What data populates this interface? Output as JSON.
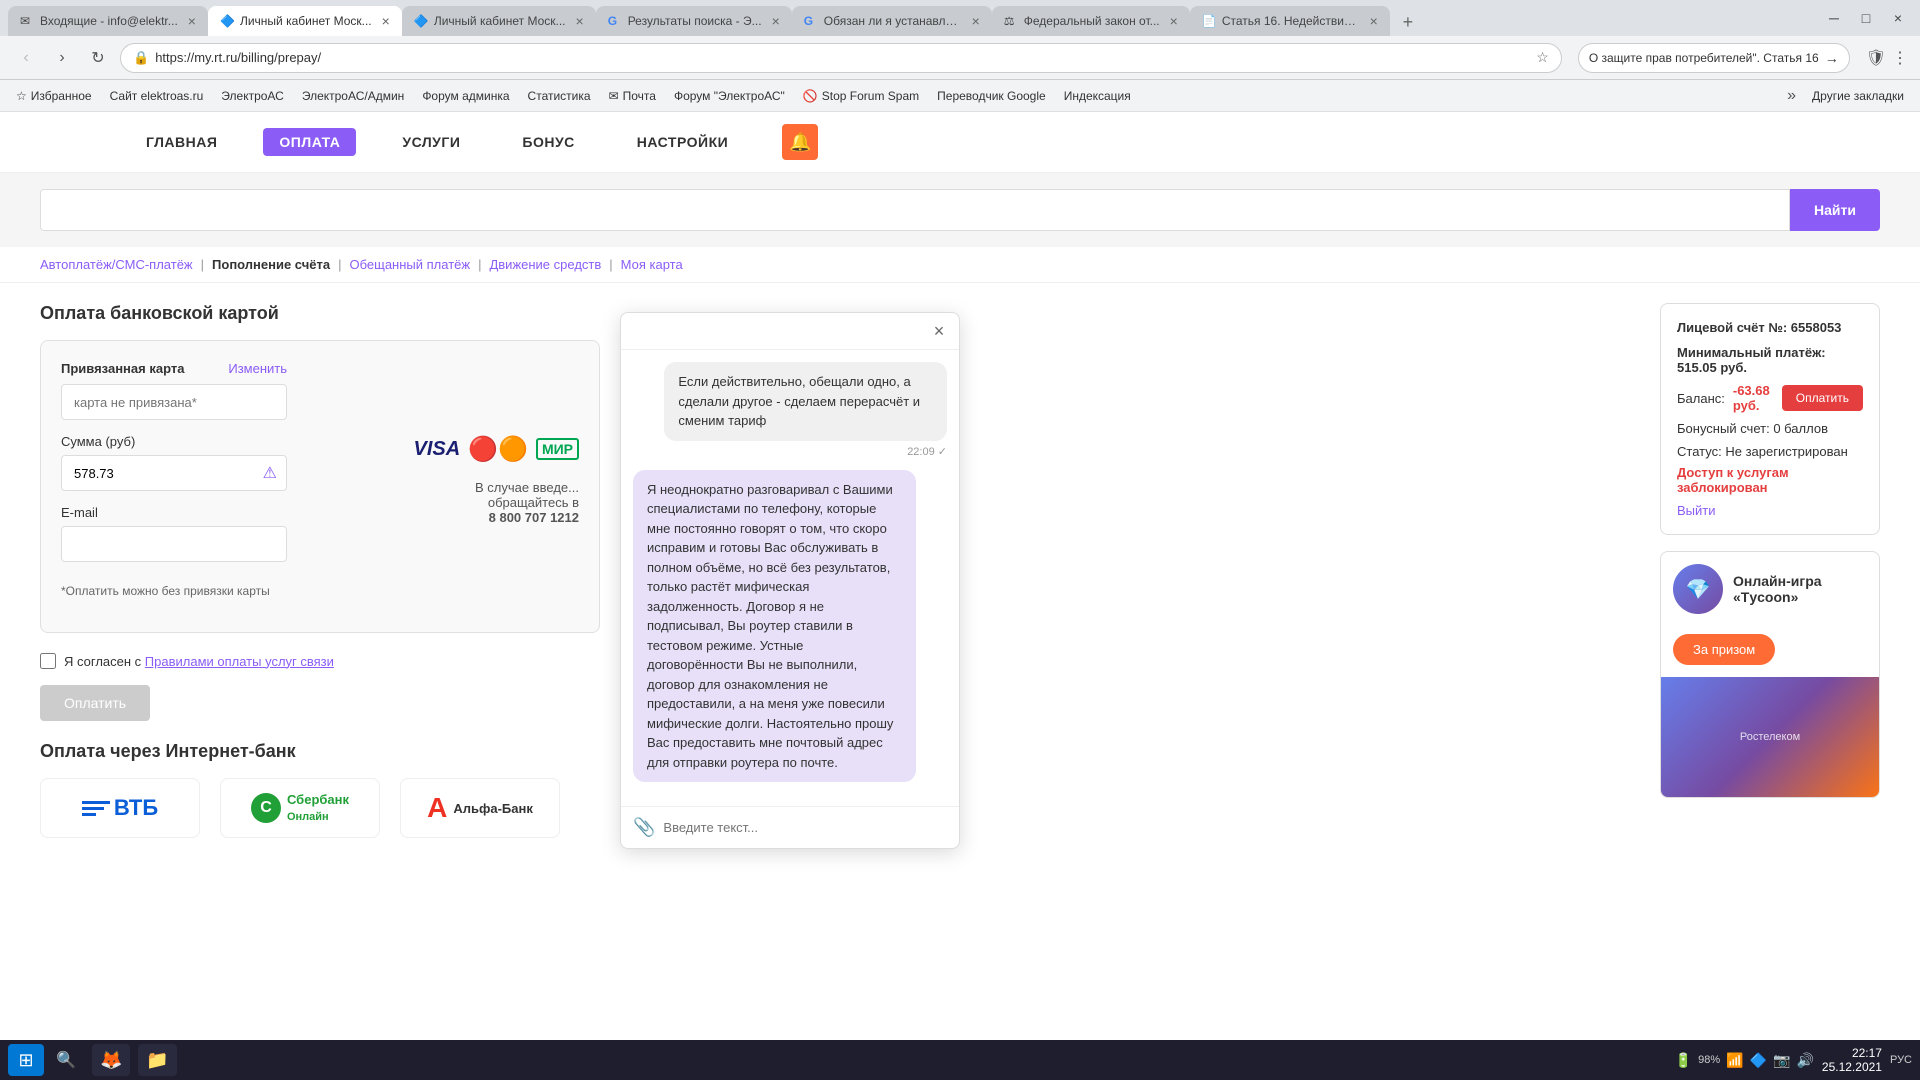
{
  "browser": {
    "tabs": [
      {
        "id": 1,
        "title": "Входящие - info@elektr...",
        "active": false,
        "favicon": "✉"
      },
      {
        "id": 2,
        "title": "Личный кабинет Моск...",
        "active": true,
        "favicon": "🔷"
      },
      {
        "id": 3,
        "title": "Личный кабинет Моск...",
        "active": false,
        "favicon": "🔷"
      },
      {
        "id": 4,
        "title": "Результаты поиска - Э...",
        "active": false,
        "favicon": "G"
      },
      {
        "id": 5,
        "title": "Обязан ли я устанавли...",
        "active": false,
        "favicon": "G"
      },
      {
        "id": 6,
        "title": "Федеральный закон от...",
        "active": false,
        "favicon": "⚖"
      },
      {
        "id": 7,
        "title": "Статья 16. Недействите...",
        "active": false,
        "favicon": "📄"
      }
    ],
    "address": "https://my.rt.ru/billing/prepay/",
    "search_right": "О защите прав потребителей\". Статья 16"
  },
  "bookmarks": [
    {
      "label": "Избранное"
    },
    {
      "label": "Сайт elektroas.ru"
    },
    {
      "label": "ЭлектроАС"
    },
    {
      "label": "ЭлектроАС/Админ"
    },
    {
      "label": "Форум админка"
    },
    {
      "label": "Статистика"
    },
    {
      "label": "Почта"
    },
    {
      "label": "Форум \"ЭлектроАС\""
    },
    {
      "label": "Stop Forum Spam"
    },
    {
      "label": "Переводчик Google"
    },
    {
      "label": "Индексация"
    }
  ],
  "nav": {
    "items": [
      {
        "label": "ГЛАВНАЯ",
        "active": false
      },
      {
        "label": "ОПЛАТА",
        "active": true
      },
      {
        "label": "УСЛУГИ",
        "active": false
      },
      {
        "label": "БОНУС",
        "active": false
      },
      {
        "label": "НАСТРОЙКИ",
        "active": false
      }
    ]
  },
  "search": {
    "placeholder": "",
    "button_label": "Найти"
  },
  "breadcrumb": {
    "items": [
      {
        "label": "Автоплатёж/СМС-платёж",
        "active": false
      },
      {
        "label": "Пополнение счёта",
        "active": true
      },
      {
        "label": "Обещанный платёж",
        "active": false
      },
      {
        "label": "Движение средств",
        "active": false
      },
      {
        "label": "Моя карта",
        "active": false
      }
    ]
  },
  "payment_card": {
    "section_title": "Оплата банковской картой",
    "linked_card_label": "Привязанная карта",
    "change_link": "Изменить",
    "card_placeholder": "карта не привязана*",
    "amount_label": "Сумма (руб)",
    "amount_value": "578.73",
    "email_label": "E-mail",
    "email_placeholder": "",
    "note": "*Оплатить можно без привязки карты",
    "phone_note": "В случае введе... обращайтесь в 8 800 707 1212",
    "phone": "8 800 707 1212",
    "phone_prefix": "В случае введе... обращайтесь в"
  },
  "checkbox": {
    "label": "Я согласен с ",
    "link_label": "Правилами оплаты услуг связи"
  },
  "pay_button": "Оплатить",
  "internet_bank": {
    "title": "Оплата через Интернет-банк"
  },
  "sidebar": {
    "account_label": "Лицевой счёт №:",
    "account_number": "6558053",
    "min_payment_label": "Минимальный платёж:",
    "min_payment_value": "515.05",
    "min_payment_currency": "руб.",
    "balance_label": "Баланс:",
    "balance_value": "-63.68",
    "balance_currency": "руб.",
    "pay_button": "Оплатить",
    "bonus_label": "Бонусный счет:",
    "bonus_value": "0 баллов",
    "status_label": "Статус:",
    "status_value": "Не зарегистрирован",
    "blocked_text": "Доступ к услугам заблокирован",
    "logout": "Выйти"
  },
  "ad": {
    "title": "Онлайн-игра «Тycoon»",
    "button": "За призом"
  },
  "chat": {
    "close": "×",
    "messages": [
      {
        "type": "right",
        "text": "Если действительно, обещали одно, а сделали другое - сделаем перерасчёт и сменим тариф",
        "time": "22:09",
        "read": true
      },
      {
        "type": "left",
        "text": "Я неоднократно разговаривал с Вашими специалистами по телефону, которые мне постоянно говорят о том, что скоро исправим и готовы Вас обслуживать в полном объёме, но всё без результатов, только растёт мифическая задолженность. Договор я не подписывал, Вы роутер ставили в тестовом режиме. Устные договорённости Вы не выполнили, договор для ознакомления не предоставили, а на меня уже повесили мифические долги. Настоятельно прошу Вас предоставить мне почтовый адрес для отправки роутера по почте.",
        "time": "",
        "read": false
      }
    ],
    "input_placeholder": "Введите текст..."
  },
  "taskbar": {
    "time": "22:17",
    "date": "25.12.2021",
    "battery": "98%",
    "language": "РУС"
  }
}
